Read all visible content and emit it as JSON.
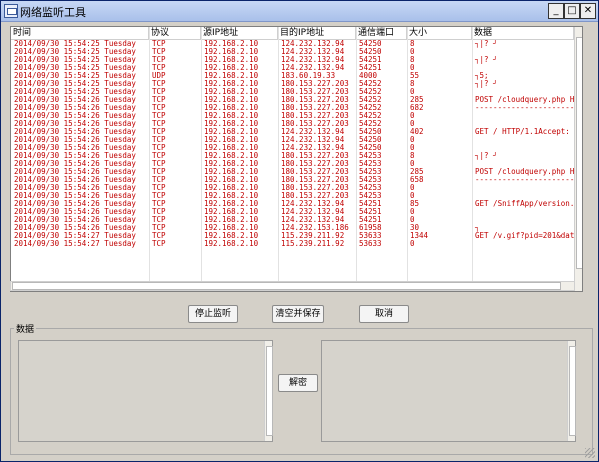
{
  "window": {
    "title": "网络监听工具"
  },
  "table": {
    "columns": [
      "时间",
      "协议",
      "源IP地址",
      "目的IP地址",
      "通信端口",
      "大小",
      "数据"
    ],
    "rows": [
      [
        "2014/09/30 15:54:25 Tuesday",
        "TCP",
        "192.168.2.10",
        "124.232.132.94",
        "54250",
        "8",
        "┐|?  ┘"
      ],
      [
        "2014/09/30 15:54:25 Tuesday",
        "TCP",
        "192.168.2.10",
        "124.232.132.94",
        "54250",
        "0",
        ""
      ],
      [
        "2014/09/30 15:54:25 Tuesday",
        "TCP",
        "192.168.2.10",
        "124.232.132.94",
        "54251",
        "8",
        "┐|?  ┘"
      ],
      [
        "2014/09/30 15:54:25 Tuesday",
        "TCP",
        "192.168.2.10",
        "124.232.132.94",
        "54251",
        "0",
        ""
      ],
      [
        "2014/09/30 15:54:25 Tuesday",
        "UDP",
        "192.168.2.10",
        "183.60.19.33",
        "4000",
        "55",
        "┐5;"
      ],
      [
        "2014/09/30 15:54:25 Tuesday",
        "TCP",
        "192.168.2.10",
        "180.153.227.203",
        "54252",
        "8",
        "┐|?  ┘"
      ],
      [
        "2014/09/30 15:54:25 Tuesday",
        "TCP",
        "192.168.2.10",
        "180.153.227.203",
        "54252",
        "0",
        ""
      ],
      [
        "2014/09/30 15:54:26 Tuesday",
        "TCP",
        "192.168.2.10",
        "180.153.227.203",
        "54252",
        "285",
        "POST /cloudquery.php HTT"
      ],
      [
        "2014/09/30 15:54:26 Tuesday",
        "TCP",
        "192.168.2.10",
        "180.153.227.203",
        "54252",
        "682",
        "------------------------"
      ],
      [
        "2014/09/30 15:54:26 Tuesday",
        "TCP",
        "192.168.2.10",
        "180.153.227.203",
        "54252",
        "0",
        ""
      ],
      [
        "2014/09/30 15:54:26 Tuesday",
        "TCP",
        "192.168.2.10",
        "180.153.227.203",
        "54252",
        "0",
        ""
      ],
      [
        "2014/09/30 15:54:26 Tuesday",
        "TCP",
        "192.168.2.10",
        "124.232.132.94",
        "54250",
        "402",
        "GET / HTTP/1.1Accept: */"
      ],
      [
        "2014/09/30 15:54:26 Tuesday",
        "TCP",
        "192.168.2.10",
        "124.232.132.94",
        "54250",
        "0",
        ""
      ],
      [
        "2014/09/30 15:54:26 Tuesday",
        "TCP",
        "192.168.2.10",
        "124.232.132.94",
        "54250",
        "0",
        ""
      ],
      [
        "2014/09/30 15:54:26 Tuesday",
        "TCP",
        "192.168.2.10",
        "180.153.227.203",
        "54253",
        "8",
        "┐|?  ┘"
      ],
      [
        "2014/09/30 15:54:26 Tuesday",
        "TCP",
        "192.168.2.10",
        "180.153.227.203",
        "54253",
        "0",
        ""
      ],
      [
        "2014/09/30 15:54:26 Tuesday",
        "TCP",
        "192.168.2.10",
        "180.153.227.203",
        "54253",
        "285",
        "POST /cloudquery.php HTT"
      ],
      [
        "2014/09/30 15:54:26 Tuesday",
        "TCP",
        "192.168.2.10",
        "180.153.227.203",
        "54253",
        "658",
        "------------------------"
      ],
      [
        "2014/09/30 15:54:26 Tuesday",
        "TCP",
        "192.168.2.10",
        "180.153.227.203",
        "54253",
        "0",
        ""
      ],
      [
        "2014/09/30 15:54:26 Tuesday",
        "TCP",
        "192.168.2.10",
        "180.153.227.203",
        "54253",
        "0",
        ""
      ],
      [
        "2014/09/30 15:54:26 Tuesday",
        "TCP",
        "192.168.2.10",
        "124.232.132.94",
        "54251",
        "85",
        "GET /SniffApp/version.as"
      ],
      [
        "2014/09/30 15:54:26 Tuesday",
        "TCP",
        "192.168.2.10",
        "124.232.132.94",
        "54251",
        "0",
        ""
      ],
      [
        "2014/09/30 15:54:26 Tuesday",
        "TCP",
        "192.168.2.10",
        "124.232.132.94",
        "54251",
        "0",
        ""
      ],
      [
        "2014/09/30 15:54:26 Tuesday",
        "TCP",
        "192.168.2.10",
        "124.232.153.186",
        "61958",
        "30",
        "┐"
      ],
      [
        "2014/09/30 15:54:27 Tuesday",
        "TCP",
        "192.168.2.10",
        "115.239.211.92",
        "53633",
        "1344",
        "GET /v.gif?pid=201&data="
      ],
      [
        "2014/09/30 15:54:27 Tuesday",
        "TCP",
        "192.168.2.10",
        "115.239.211.92",
        "53633",
        "0",
        ""
      ]
    ]
  },
  "buttons": {
    "stop": "停止监听",
    "clear_save": "清空并保存",
    "cancel": "取消",
    "decode": "解密"
  },
  "data_group": {
    "label": "数据"
  },
  "colors": {
    "row_text": "#c00000"
  },
  "icons": {
    "app": "window-app-icon",
    "minimize": "minimize-icon",
    "maximize": "maximize-icon",
    "close": "close-icon"
  }
}
